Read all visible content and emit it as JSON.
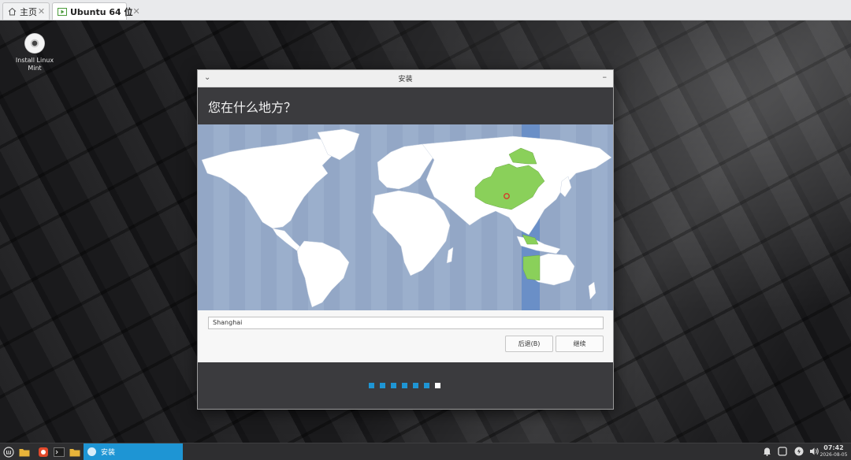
{
  "vm_tabs": [
    {
      "label": "主页",
      "icon": "home-icon",
      "active": false
    },
    {
      "label": "Ubuntu 64 位",
      "icon": "vm-play-icon",
      "active": true
    }
  ],
  "desktop_icons": [
    {
      "label": "Install Linux Mint",
      "icon": "disc-icon"
    }
  ],
  "installer": {
    "window_title": "安装",
    "heading": "您在什么地方？",
    "timezone_value": "Shanghai",
    "back_button": "后退(B)",
    "continue_button": "继续",
    "progress": {
      "total_steps": 7,
      "current_step": 7
    }
  },
  "taskbar": {
    "active_app_label": "安装",
    "clock_time": "07:42",
    "clock_date": "2026-08-05"
  },
  "colors": {
    "accent": "#1e95d4",
    "map_water": "#93a7c6",
    "selected_region": "#8ad05a",
    "timezone_band": "#6a8fc7"
  }
}
